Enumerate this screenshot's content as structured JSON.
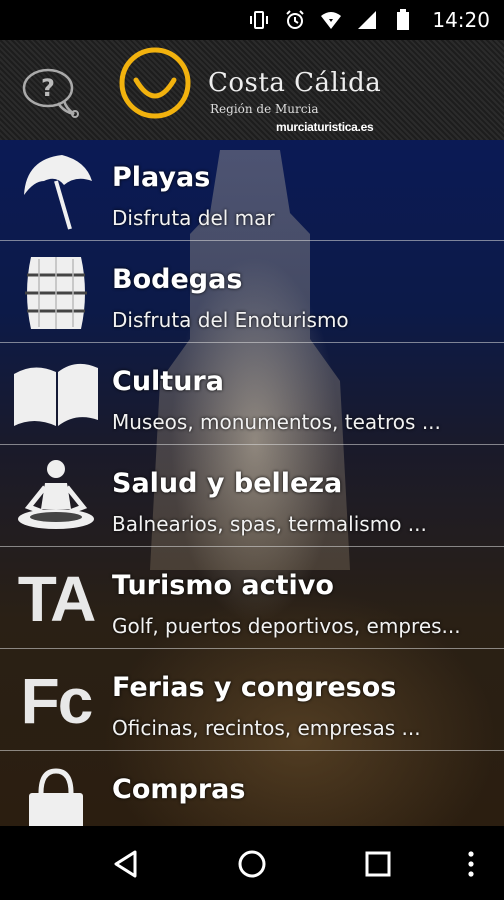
{
  "status_bar": {
    "time": "14:20",
    "icons": [
      "vibrate-icon",
      "alarm-icon",
      "wifi-icon",
      "signal-icon",
      "battery-icon"
    ]
  },
  "header": {
    "help_icon": "help-bubble-icon",
    "brand_title": "Costa Cálida",
    "brand_subtitle": "Región de Murcia",
    "brand_url": "murciaturistica.es",
    "accent_color": "#f2b20e"
  },
  "menu": {
    "items": [
      {
        "title": "Playas",
        "subtitle": "Disfruta del mar",
        "icon": "beach-umbrella-icon"
      },
      {
        "title": "Bodegas",
        "subtitle": "Disfruta del Enoturismo",
        "icon": "wine-barrel-icon"
      },
      {
        "title": "Cultura",
        "subtitle": "Museos, monumentos, teatros ...",
        "icon": "open-book-icon"
      },
      {
        "title": "Salud y belleza",
        "subtitle": "Balnearios, spas, termalismo ...",
        "icon": "meditation-icon"
      },
      {
        "title": "Turismo activo",
        "subtitle": "Golf, puertos deportivos, empres...",
        "icon": "ta-letters-icon",
        "icon_text": "TA"
      },
      {
        "title": "Ferias y congresos",
        "subtitle": "Oficinas, recintos, empresas ...",
        "icon": "fc-letters-icon",
        "icon_text": "Fc"
      },
      {
        "title": "Compras",
        "subtitle": "",
        "icon": "shopping-bag-icon"
      }
    ]
  },
  "nav_bar": {
    "buttons": [
      "back-icon",
      "home-icon",
      "recents-icon",
      "more-icon"
    ]
  }
}
